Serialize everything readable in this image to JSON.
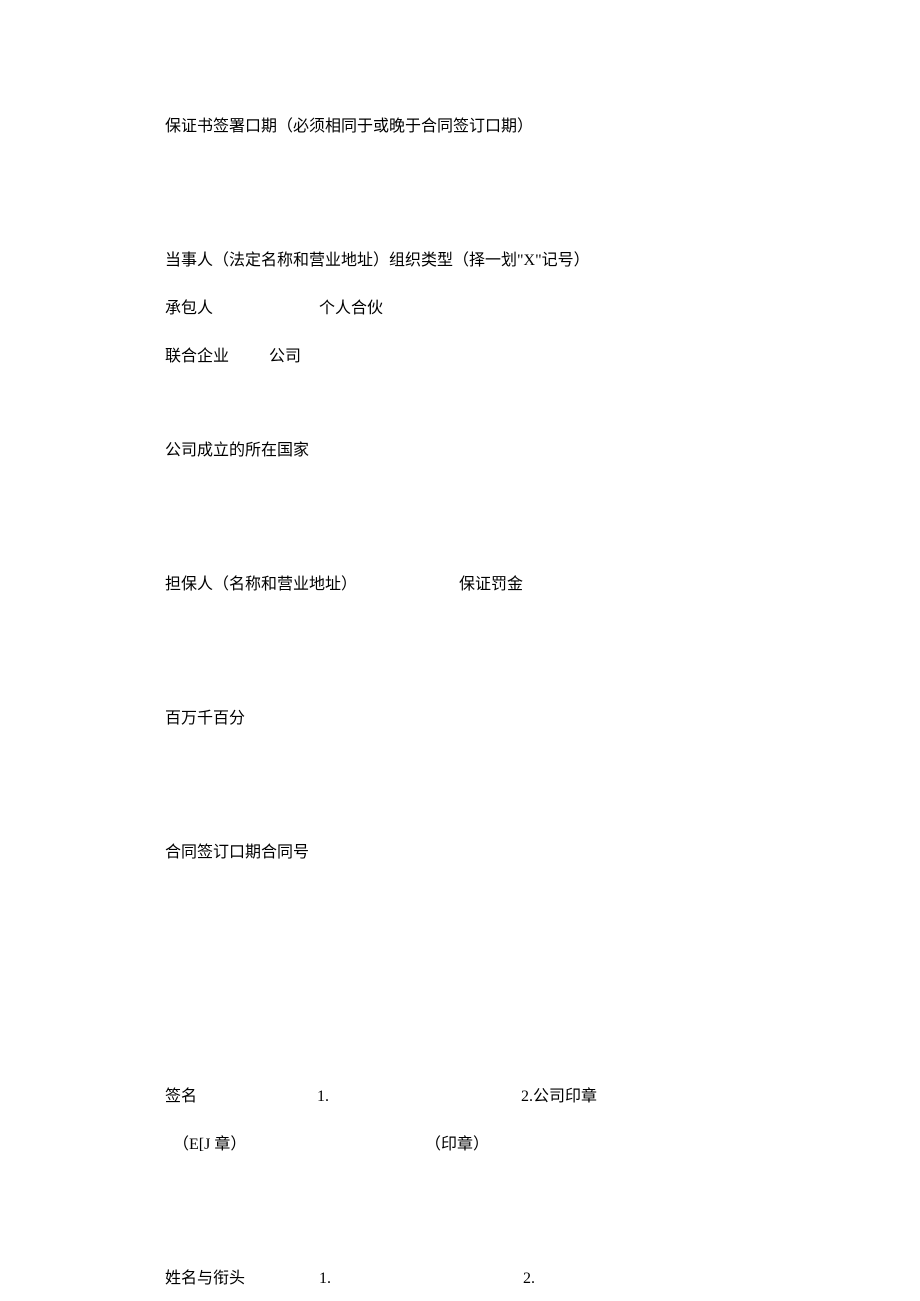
{
  "line1": "保证书签署口期（必须相同于或晚于合同签订口期）",
  "line2": "当事人（法定名称和营业地址）组织类型（择一划\"X\"记号）",
  "line3_a": "承包人",
  "line3_b": "个人合伙",
  "line4_a": "联合企业",
  "line4_b": "公司",
  "line5": "公司成立的所在国家",
  "line6_a": "担保人（名称和营业地址）",
  "line6_b": "保证罚金",
  "line7": "百万千百分",
  "line8": "合同签订口期合同号",
  "line9_a": "签名",
  "line9_b": "1.",
  "line9_c": "2.公司印章",
  "line10_a": "（E[J 章）",
  "line10_b": "（印章）",
  "line11_a": "姓名与衔头",
  "line11_b": "1.",
  "line11_c": "2."
}
